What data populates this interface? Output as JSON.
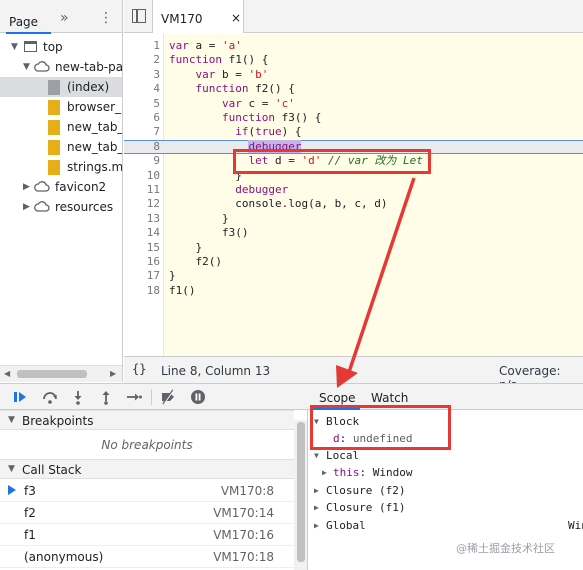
{
  "navigator": {
    "tab_page": "Page",
    "more_icon": "»",
    "menu_icon": "⋮",
    "tree": [
      {
        "label": "top",
        "icon": "frame-icon"
      },
      {
        "label": "new-tab-page",
        "icon": "cloud-icon"
      },
      {
        "label": "(index)",
        "icon": "file-icon",
        "selected": true
      },
      {
        "label": "browser_proxy.js",
        "icon": "file-icon"
      },
      {
        "label": "new_tab_page.js",
        "icon": "file-icon"
      },
      {
        "label": "new_tab_page_proxy.js",
        "icon": "file-icon"
      },
      {
        "label": "strings.m.js",
        "icon": "file-icon"
      },
      {
        "label": "favicon2",
        "icon": "cloud-icon"
      },
      {
        "label": "resources",
        "icon": "cloud-icon"
      }
    ]
  },
  "editor": {
    "file_tab": "VM170",
    "close_icon": "×",
    "line_numbers": [
      "1",
      "2",
      "3",
      "4",
      "5",
      "6",
      "7",
      "8",
      "9",
      "10",
      "11",
      "12",
      "13",
      "14",
      "15",
      "16",
      "17",
      "18"
    ],
    "code_lines": [
      "var a = 'a'",
      "function f1() {",
      "    var b = 'b'",
      "    function f2() {",
      "        var c = 'c'",
      "        function f3() {",
      "          if(true) {",
      "            debugger",
      "            let d = 'd' // var 改为 Let",
      "          }",
      "          debugger",
      "          console.log(a, b, c, d)",
      "        }",
      "        f3()",
      "    }",
      "    f2()",
      "}",
      "f1()"
    ],
    "format_icon": "{}",
    "cursor_position": "Line 8, Column 13",
    "coverage": "Coverage: n/a"
  },
  "breakpoints": {
    "title": "Breakpoints",
    "empty_text": "No breakpoints"
  },
  "call_stack": {
    "title": "Call Stack",
    "frames": [
      {
        "name": "f3",
        "location": "VM170:8",
        "current": true
      },
      {
        "name": "f2",
        "location": "VM170:14"
      },
      {
        "name": "f1",
        "location": "VM170:16"
      },
      {
        "name": "(anonymous)",
        "location": "VM170:18"
      }
    ]
  },
  "scope": {
    "tab_scope": "Scope",
    "tab_watch": "Watch",
    "block_label": "Block",
    "block_var_name": "d",
    "block_var_value": "undefined",
    "local_label": "Local",
    "local_this_name": "this",
    "local_this_value": "Window",
    "closure_f2": "Closure (f2)",
    "closure_f1": "Closure (f1)",
    "global_label": "Global",
    "global_value": "Win"
  },
  "watermark": "@稀土掘金技术社区",
  "colors": {
    "accent": "#1a73e8",
    "annotation_red": "#e53935",
    "code_bg": "#fffde7"
  }
}
